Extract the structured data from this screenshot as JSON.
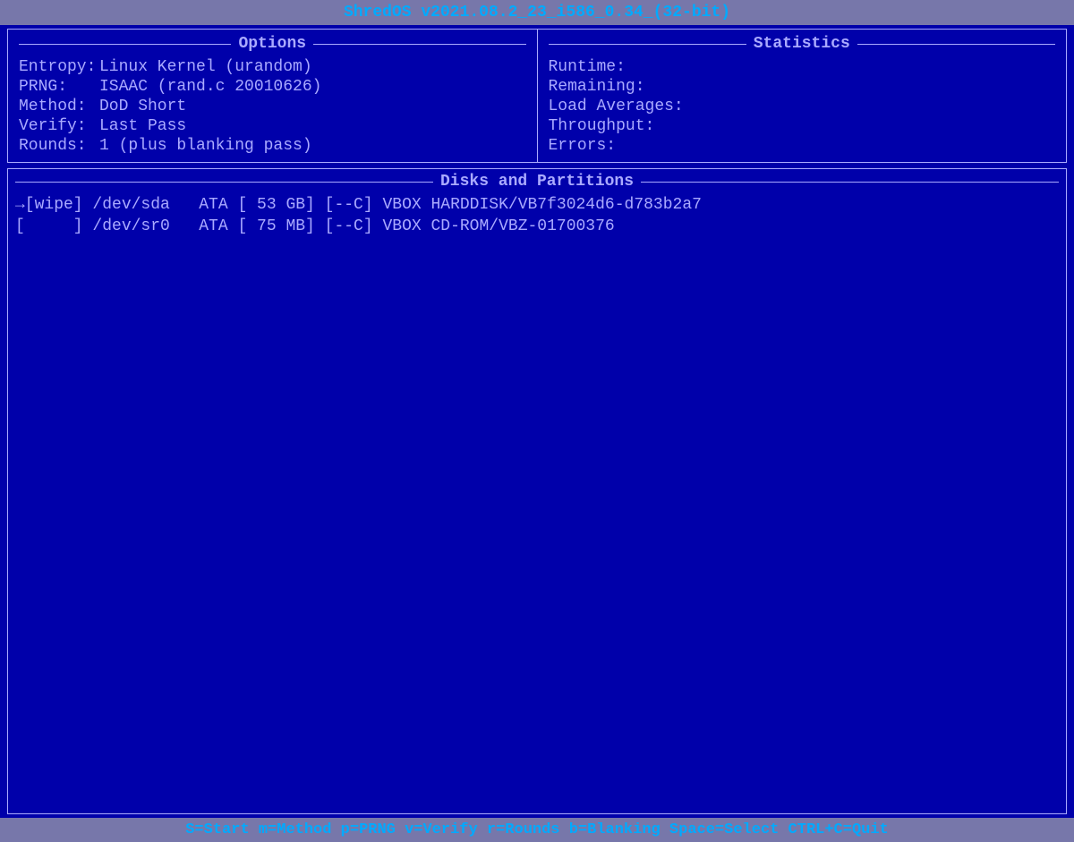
{
  "title": "ShredOS v2021.08.2_23_i586_0.34_(32-bit)",
  "options_title": "Options",
  "statistics_title": "Statistics",
  "disks_title": "Disks and Partitions",
  "options": {
    "entropy_label": "Entropy:",
    "entropy_value": "Linux Kernel (urandom)",
    "prng_label": "PRNG:",
    "prng_value": "ISAAC (rand.c 20010626)",
    "method_label": "Method:",
    "method_value": "DoD Short",
    "verify_label": "Verify:",
    "verify_value": "Last Pass",
    "rounds_label": "Rounds:",
    "rounds_value": "1 (plus blanking pass)"
  },
  "statistics": {
    "runtime_label": "Runtime:",
    "runtime_value": "",
    "remaining_label": "Remaining:",
    "remaining_value": "",
    "load_avg_label": "Load Averages:",
    "load_avg_value": "",
    "throughput_label": "Throughput:",
    "throughput_value": "",
    "errors_label": "Errors:",
    "errors_value": ""
  },
  "disks": [
    {
      "prefix": "→[wipe]",
      "device": "/dev/sda",
      "type": "ATA",
      "size": "[ 53 GB]",
      "flags": "[--C]",
      "name": "VBOX HARDDISK/VB7f3024d6-d783b2a7"
    },
    {
      "prefix": "[     ]",
      "device": "/dev/sr0",
      "type": "ATA",
      "size": "[ 75 MB]",
      "flags": "[--C]",
      "name": "VBOX CD-ROM/VBZ-01700376"
    }
  ],
  "bottom_bar": "S=Start  m=Method  p=PRNG  v=Verify  r=Rounds  b=Blanking  Space=Select  CTRL+C=Quit"
}
